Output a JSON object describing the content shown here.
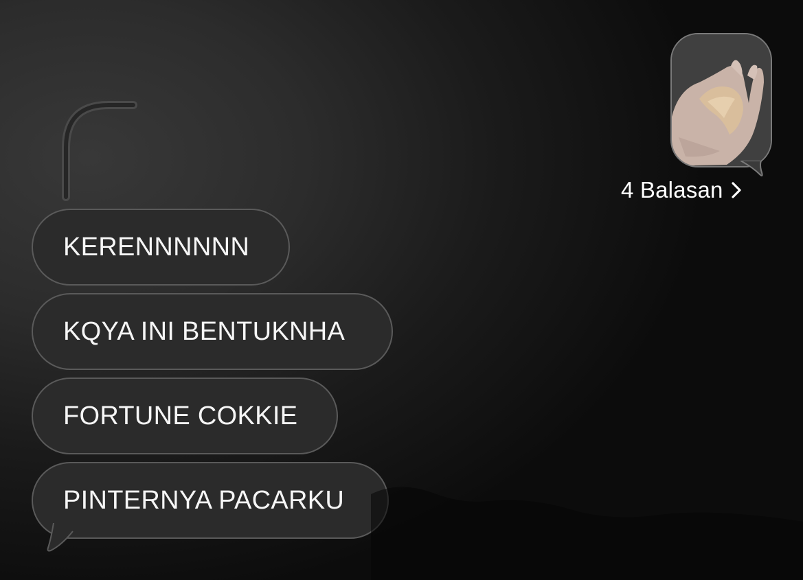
{
  "messages": [
    {
      "text": "KERENNNNNN"
    },
    {
      "text": "KQYA INI BENTUKNHA"
    },
    {
      "text": "FORTUNE COKKIE"
    },
    {
      "text": "PINTERNYA PACARKU"
    }
  ],
  "attachment": {
    "icon": "photo-thumbnail",
    "replies_label": "4 Balasan",
    "chevron_icon": "chevron-right-icon"
  },
  "colors": {
    "bubble_bg": "#2b2b2b",
    "bubble_border": "#5a5a5a",
    "text": "#f6f6f6"
  }
}
